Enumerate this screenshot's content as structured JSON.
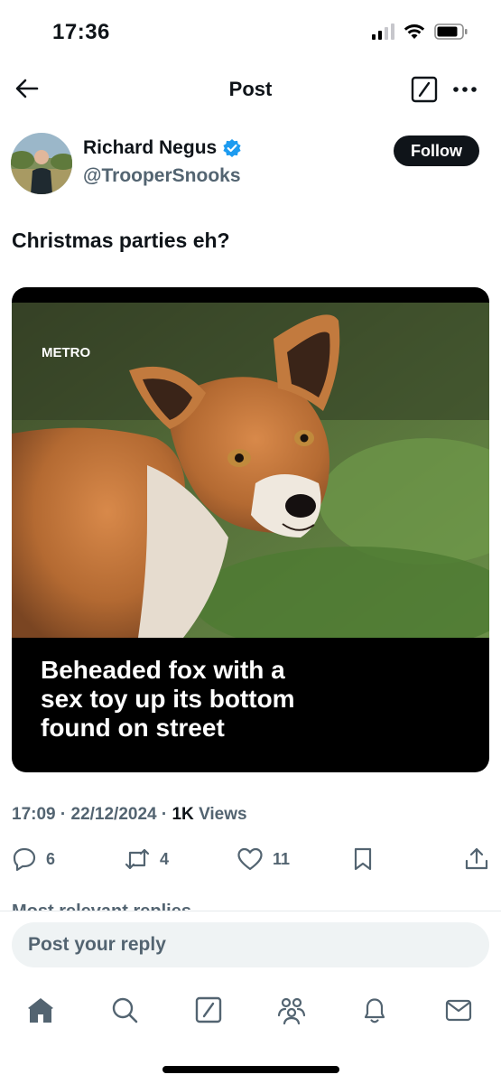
{
  "status_bar": {
    "time": "17:36",
    "icons": [
      "cellular-signal-icon",
      "wifi-icon",
      "battery-icon"
    ]
  },
  "header": {
    "title": "Post",
    "icons": [
      "back-arrow-icon",
      "grok-icon",
      "more-options-icon"
    ]
  },
  "author": {
    "name": "Richard Negus",
    "handle": "@TrooperSnooks",
    "verified": true,
    "follow_label": "Follow"
  },
  "post": {
    "text": "Christmas parties eh?",
    "media": {
      "watermark": "METRO",
      "caption_lines": [
        "Beheaded fox with a",
        "sex toy up its bottom",
        "found on street"
      ]
    },
    "time": "17:09",
    "date": "22/12/2024",
    "views_count": "1K",
    "views_label": "Views",
    "separator": "·"
  },
  "actions": {
    "replies": "6",
    "reposts": "4",
    "likes": "11"
  },
  "replies_section": {
    "label": "Most relevant replies"
  },
  "reply_box": {
    "placeholder": "Post your reply"
  },
  "tabbar": {
    "tabs": [
      "home-icon",
      "search-icon",
      "grok-icon",
      "communities-icon",
      "notifications-icon",
      "messages-icon"
    ]
  },
  "colors": {
    "text_primary": "#0f1419",
    "text_secondary": "#536471",
    "verified_blue": "#1d9bf0",
    "reply_bar_bg": "#eff3f4"
  }
}
